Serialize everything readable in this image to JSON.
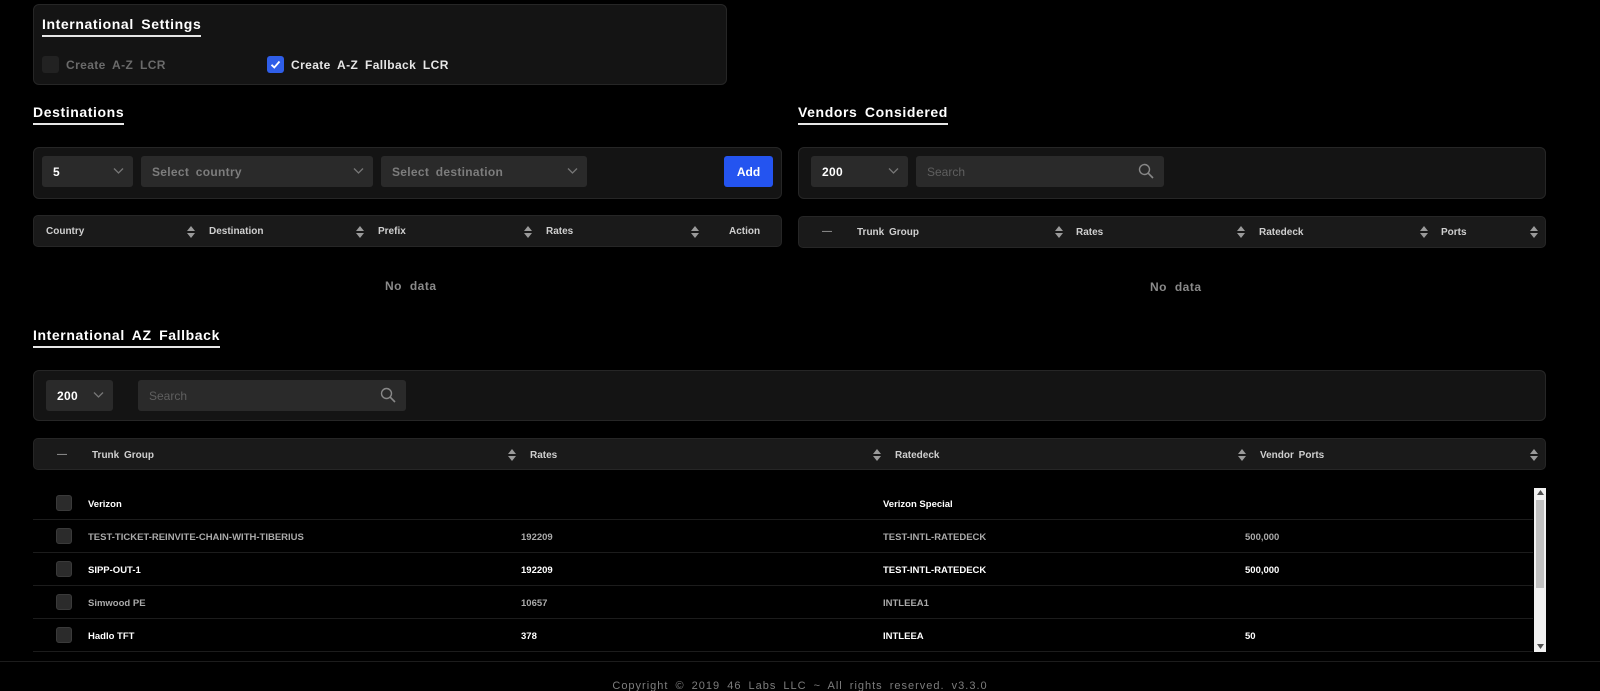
{
  "intl_settings": {
    "title": "International  Settings",
    "opt_az_lcr": {
      "label": "Create  A-Z  LCR",
      "checked": false
    },
    "opt_az_fallback": {
      "label": "Create  A-Z  Fallback  LCR",
      "checked": true
    }
  },
  "destinations": {
    "title": "Destinations",
    "page_size": "5",
    "country_placeholder": "Select  country",
    "destination_placeholder": "Select  destination",
    "add_label": "Add",
    "columns": [
      "Country",
      "Destination",
      "Prefix",
      "Rates",
      "Action"
    ],
    "empty": "No  data"
  },
  "vendors": {
    "title": "Vendors  Considered",
    "page_size": "200",
    "search_placeholder": "Search",
    "columns": [
      "Trunk  Group",
      "Rates",
      "Ratedeck",
      "Ports"
    ],
    "empty": "No  data"
  },
  "fallback": {
    "title": "International  AZ  Fallback",
    "page_size": "200",
    "search_placeholder": "Search",
    "columns": [
      "Trunk  Group",
      "Rates",
      "Ratedeck",
      "Vendor  Ports"
    ],
    "rows": [
      {
        "trunk": "Verizon",
        "rates": "",
        "ratedeck": "Verizon  Special",
        "ports": ""
      },
      {
        "trunk": "TEST-TICKET-REINVITE-CHAIN-WITH-TIBERIUS",
        "rates": "192209",
        "ratedeck": "TEST-INTL-RATEDECK",
        "ports": "500,000"
      },
      {
        "trunk": "SIPP-OUT-1",
        "rates": "192209",
        "ratedeck": "TEST-INTL-RATEDECK",
        "ports": "500,000"
      },
      {
        "trunk": "Simwood  PE",
        "rates": "10657",
        "ratedeck": "INTLEEA1",
        "ports": ""
      },
      {
        "trunk": "Hadlo  TFT",
        "rates": "378",
        "ratedeck": "INTLEEA",
        "ports": "50"
      }
    ]
  },
  "footer": {
    "text": "Copyright  ©  2019  46  Labs  LLC  ~  All  rights  reserved.  v3.3.0"
  },
  "colors": {
    "accent": "#2454f0",
    "background": "#000000",
    "panel": "#141414"
  }
}
